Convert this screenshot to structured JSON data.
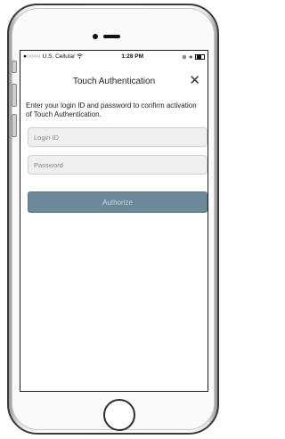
{
  "status_bar": {
    "signal": "●○○○○",
    "carrier": "U.S. Cellular",
    "wifi_icon": "wifi-icon",
    "time": "1:28 PM",
    "right_icons": "⊕ ∗"
  },
  "modal": {
    "title": "Touch Authentication",
    "close_label": "✕",
    "instructions": "Enter your login ID and password to confirm activation of Touch Authentication.",
    "login_placeholder": "Login ID",
    "password_placeholder": "Password",
    "authorize_label": "Authorize"
  },
  "colors": {
    "button_bg": "#6a8a9a",
    "button_text": "#c9d9e2",
    "field_bg": "#efefef"
  }
}
